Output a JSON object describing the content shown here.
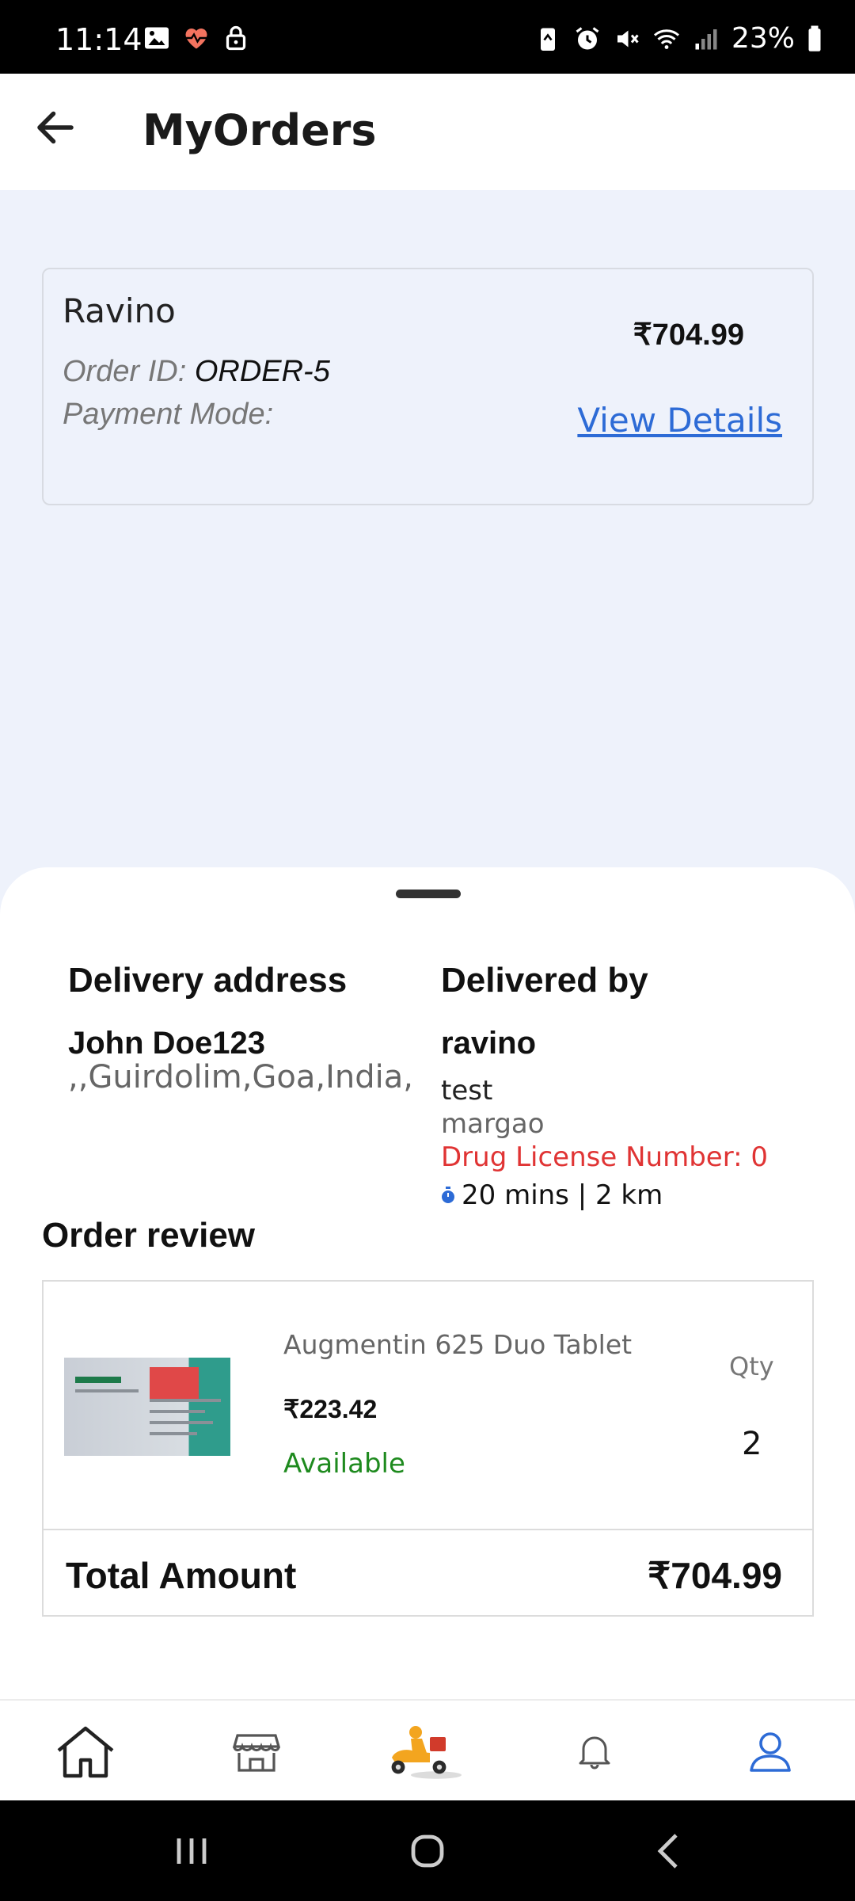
{
  "status_bar": {
    "time": "11:14",
    "battery": "23%",
    "left_icons": [
      "image-icon",
      "heart-pulse-icon",
      "lock-icon"
    ],
    "right_icons": [
      "battery-saver-icon",
      "alarm-icon",
      "mute-icon",
      "wifi-icon",
      "signal-icon",
      "battery-icon"
    ]
  },
  "header": {
    "title": "MyOrders",
    "back_icon": "arrow-left-icon"
  },
  "order": {
    "shop": "Ravino",
    "order_id_label": "Order ID: ",
    "order_id": "ORDER-5",
    "payment_label": "Payment Mode:",
    "price": "₹704.99",
    "view_details": "View Details"
  },
  "delivery": {
    "address_heading": "Delivery address",
    "customer_name": "John Doe123",
    "address_line": ",,Guirdolim,Goa,India,",
    "delivered_by_heading": "Delivered by",
    "seller_name": "ravino",
    "seller_line1": "test",
    "seller_line2": "margao",
    "license": "Drug License Number: 0",
    "eta": "20 mins | 2 km"
  },
  "review": {
    "heading": "Order review",
    "items": [
      {
        "name": "Augmentin 625 Duo Tablet",
        "price": "₹223.42",
        "status": "Available",
        "qty_label": "Qty",
        "qty": "2"
      }
    ],
    "total_label": "Total Amount",
    "total_value": "₹704.99"
  },
  "bottom_nav": {
    "items": [
      "home-icon",
      "store-icon",
      "delivery-scooter-icon",
      "bell-icon",
      "profile-icon"
    ],
    "active": "profile-icon",
    "active_color": "#2d6bd6"
  },
  "colors": {
    "accent": "#2d6bd6",
    "page_bg": "#eef2fb",
    "error": "#e03434",
    "success": "#1e8a1e"
  }
}
